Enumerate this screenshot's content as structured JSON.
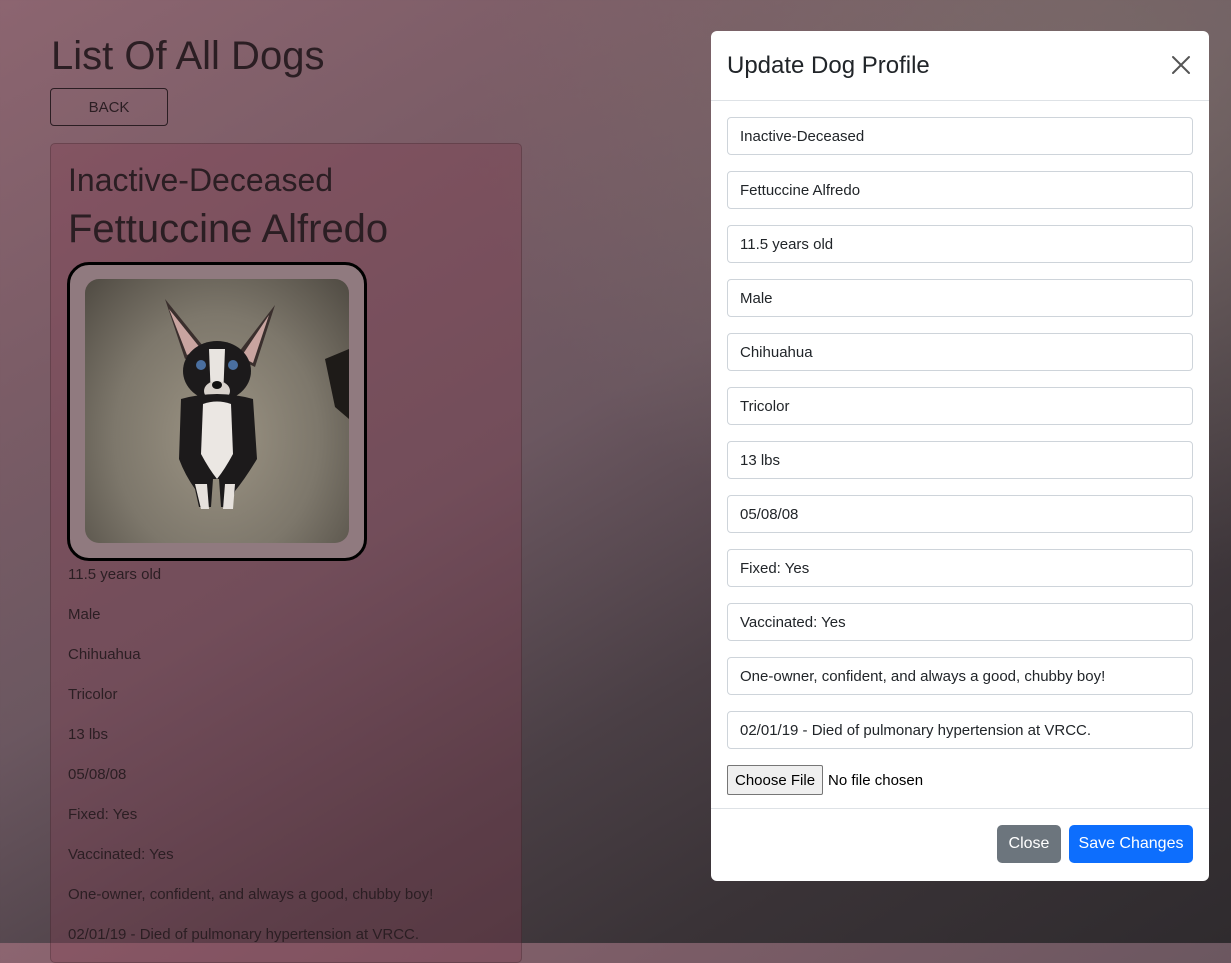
{
  "page": {
    "title": "List Of All Dogs",
    "back_label": "BACK"
  },
  "dog_card": {
    "status": "Inactive-Deceased",
    "name": "Fettuccine Alfredo",
    "details": [
      "11.5 years old",
      "Male",
      "Chihuahua",
      "Tricolor",
      "13 lbs",
      "05/08/08",
      "Fixed: Yes",
      "Vaccinated: Yes",
      "One-owner, confident, and always a good, chubby boy!",
      "02/01/19 - Died of pulmonary hypertension at VRCC."
    ]
  },
  "modal": {
    "title": "Update Dog Profile",
    "fields": [
      "Inactive-Deceased",
      "Fettuccine Alfredo",
      "11.5 years old",
      "Male",
      "Chihuahua",
      "Tricolor",
      "13 lbs",
      "05/08/08",
      "Fixed: Yes",
      "Vaccinated: Yes",
      "One-owner, confident, and always a good, chubby boy!",
      "02/01/19 - Died of pulmonary hypertension at VRCC."
    ],
    "file_button": "Choose File",
    "file_status": "No file chosen",
    "close_label": "Close",
    "save_label": "Save Changes"
  },
  "colors": {
    "primary": "#0d6efd",
    "secondary": "#6c757d"
  }
}
